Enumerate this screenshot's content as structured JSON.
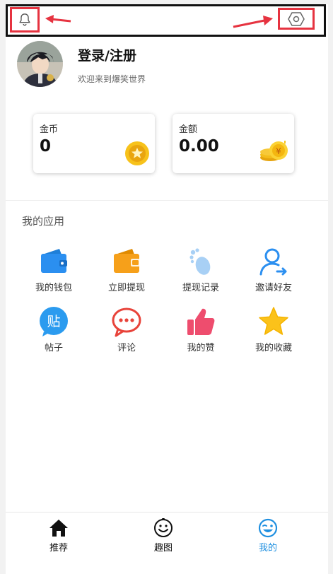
{
  "colors": {
    "accent": "#1e8fe0",
    "annotation_red": "#e63340"
  },
  "header": {
    "bell_icon": "bell-icon",
    "settings_icon": "hexagon-gear-icon"
  },
  "profile": {
    "title": "登录/注册",
    "subtitle": "欢迎来到爆笑世界"
  },
  "cards": [
    {
      "label": "金币",
      "value": "0",
      "icon": "coin-star-icon"
    },
    {
      "label": "金额",
      "value": "0.00",
      "icon": "money-stack-icon"
    }
  ],
  "apps": {
    "title": "我的应用",
    "items": [
      {
        "label": "我的钱包",
        "icon": "wallet-icon"
      },
      {
        "label": "立即提现",
        "icon": "withdraw-wallet-icon"
      },
      {
        "label": "提现记录",
        "icon": "footprint-icon"
      },
      {
        "label": "邀请好友",
        "icon": "invite-user-icon"
      },
      {
        "label": "帖子",
        "icon": "post-icon"
      },
      {
        "label": "评论",
        "icon": "comment-icon"
      },
      {
        "label": "我的赞",
        "icon": "thumbs-up-icon"
      },
      {
        "label": "我的收藏",
        "icon": "star-icon"
      }
    ]
  },
  "nav": {
    "items": [
      {
        "label": "推荐",
        "icon": "home-icon"
      },
      {
        "label": "趣图",
        "icon": "smiley-icon"
      },
      {
        "label": "我的",
        "icon": "wink-face-icon",
        "active": true
      }
    ]
  }
}
